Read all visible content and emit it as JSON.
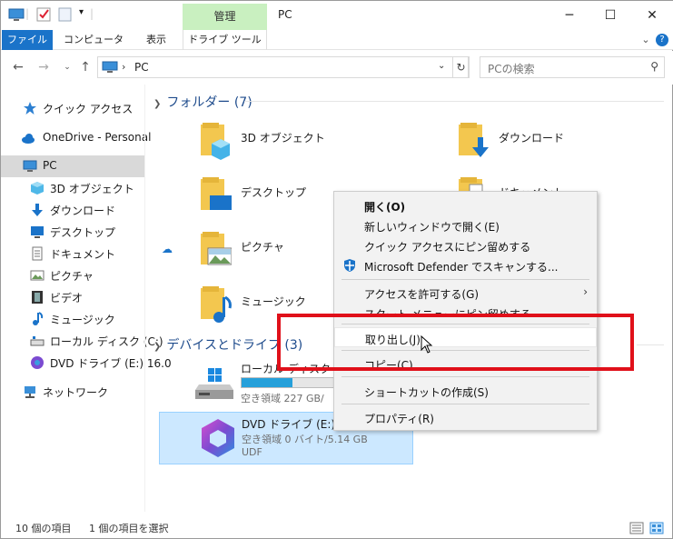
{
  "titlebar": {
    "context_tab": "管理",
    "title": "PC",
    "minimize": "─",
    "maximize": "☐",
    "close": "✕"
  },
  "ribbon": {
    "tabs": [
      "ファイル",
      "コンピューター",
      "表示",
      "ドライブ ツール"
    ],
    "expand": "⌄",
    "help": "?"
  },
  "address": {
    "crumb": "PC",
    "separator": "›",
    "search_placeholder": "PCの検索"
  },
  "sidebar": {
    "items": [
      {
        "label": "クイック アクセス",
        "icon": "star-icon"
      },
      {
        "label": "OneDrive - Personal",
        "icon": "cloud-icon"
      },
      {
        "label": "PC",
        "icon": "pc-icon"
      },
      {
        "label": "3D オブジェクト",
        "icon": "cube-icon"
      },
      {
        "label": "ダウンロード",
        "icon": "download-icon"
      },
      {
        "label": "デスクトップ",
        "icon": "desktop-icon"
      },
      {
        "label": "ドキュメント",
        "icon": "document-icon"
      },
      {
        "label": "ピクチャ",
        "icon": "picture-icon"
      },
      {
        "label": "ビデオ",
        "icon": "video-icon"
      },
      {
        "label": "ミュージック",
        "icon": "music-icon"
      },
      {
        "label": "ローカル ディスク (C:)",
        "icon": "disk-icon"
      },
      {
        "label": "DVD ドライブ (E:) 16.0",
        "icon": "dvd-icon"
      },
      {
        "label": "ネットワーク",
        "icon": "network-icon"
      }
    ]
  },
  "content": {
    "folders_header": "フォルダー (7)",
    "folders": [
      {
        "label": "3D オブジェクト",
        "icon": "cube-folder-icon"
      },
      {
        "label": "ダウンロード",
        "icon": "download-folder-icon"
      },
      {
        "label": "デスクトップ",
        "icon": "desktop-folder-icon"
      },
      {
        "label": "ドキュメント",
        "icon": "document-folder-icon"
      },
      {
        "label": "ピクチャ",
        "icon": "picture-folder-icon"
      },
      {
        "label": "ミュージック",
        "icon": "music-folder-icon"
      }
    ],
    "devices_header": "デバイスとドライブ (3)",
    "drives": [
      {
        "name": "ローカル ディスク (C:)",
        "free": "空き領域 227 GB/",
        "used_fraction": 0.3,
        "icon": "windows-disk-icon"
      },
      {
        "name": "DVD ドライブ (E:) 16.0",
        "free": "空き領域 0 バイト/5.14 GB",
        "fs": "UDF",
        "icon": "office-icon"
      }
    ]
  },
  "context_menu": {
    "items": [
      {
        "label": "開く(O)",
        "bold": true
      },
      {
        "label": "新しいウィンドウで開く(E)"
      },
      {
        "label": "クイック アクセスにピン留めする"
      },
      {
        "label": "Microsoft Defender でスキャンする..."
      },
      {
        "label": "アクセスを許可する(G)",
        "submenu": true
      },
      {
        "label": "スタート メニューにピン留めする"
      },
      {
        "label": "取り出し(J)",
        "highlighted": true
      },
      {
        "label": "コピー(C)"
      },
      {
        "label": "ショートカットの作成(S)"
      },
      {
        "label": "プロパティ(R)"
      }
    ],
    "submenu_arrow": "›"
  },
  "statusbar": {
    "count": "10 個の項目",
    "selected": "1 個の項目を選択"
  },
  "colors": {
    "accent": "#1a73c9",
    "highlight_box": "#e0101a",
    "selection": "#cce8ff",
    "manage_tab": "#c9f0c0"
  }
}
